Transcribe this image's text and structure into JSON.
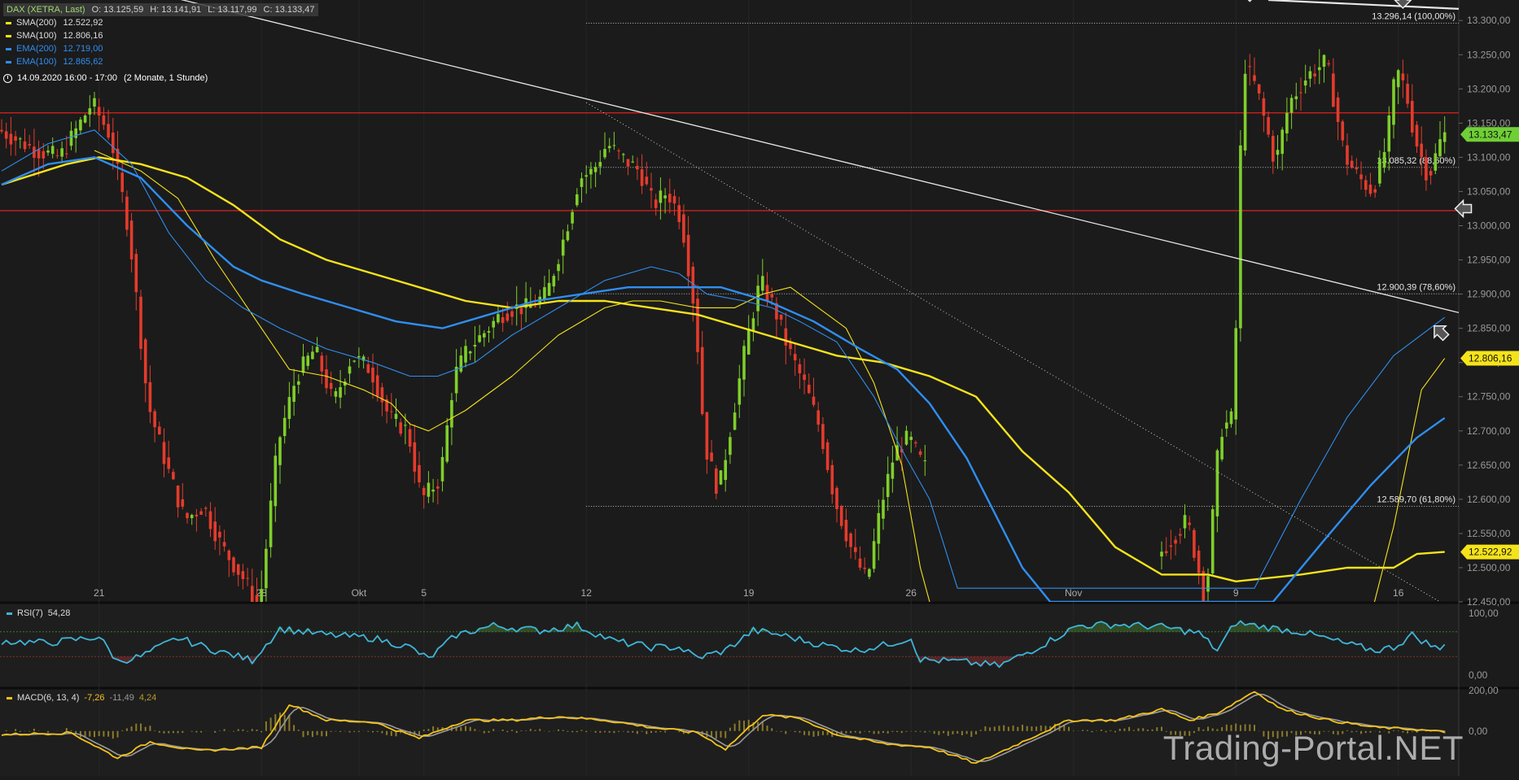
{
  "chart_header": {
    "instrument": "DAX (XETRA, Last)",
    "open": "O: 13.125,59",
    "high": "H: 13.141,91",
    "low": "L: 13.117,99",
    "close": "C: 13.133,47",
    "timestamp": "14.09.2020 16:00 - 17:00",
    "range": "(2 Monate, 1 Stunde)"
  },
  "legend": [
    {
      "label": "SMA(200)",
      "value": "12.522,92",
      "color": "#f5e31a"
    },
    {
      "label": "SMA(100)",
      "value": "12.806,16",
      "color": "#f5e31a"
    },
    {
      "label": "EMA(200)",
      "value": "12.719,00",
      "color": "#2f8ef0"
    },
    {
      "label": "EMA(100)",
      "value": "12.865,62",
      "color": "#2f8ef0"
    }
  ],
  "colors": {
    "background": "#1b1b1b",
    "up_candle": "#7fcf2a",
    "down_candle": "#e53b2c",
    "sma": "#f5e31a",
    "ema": "#2f8ef0",
    "rsi": "#3fb5d8",
    "macd": "#f3c21a",
    "resistance": "#e02020",
    "price_badge": "#6fcf35"
  },
  "chart_data": {
    "type": "candlestick",
    "ylim": [
      12450,
      13330
    ],
    "y_ticks": [
      "13.300,00",
      "13.250,00",
      "13.200,00",
      "13.150,00",
      "13.100,00",
      "13.050,00",
      "13.000,00",
      "12.950,00",
      "12.900,00",
      "12.850,00",
      "12.800,00",
      "12.750,00",
      "12.700,00",
      "12.650,00",
      "12.600,00",
      "12.550,00",
      "12.500,00",
      "12.450,00"
    ],
    "x_ticks": [
      {
        "label": "21",
        "bar": 21
      },
      {
        "label": "28",
        "bar": 56
      },
      {
        "label": "Okt",
        "bar": 77
      },
      {
        "label": "5",
        "bar": 91
      },
      {
        "label": "12",
        "bar": 126
      },
      {
        "label": "19",
        "bar": 161
      },
      {
        "label": "26",
        "bar": 196
      },
      {
        "label": "Nov",
        "bar": 231
      },
      {
        "label": "9",
        "bar": 266
      },
      {
        "label": "16",
        "bar": 301
      }
    ],
    "bar_count": 312,
    "price_path": [
      [
        0,
        13140
      ],
      [
        8,
        13110
      ],
      [
        13,
        13100
      ],
      [
        17,
        13145
      ],
      [
        20,
        13180
      ],
      [
        24,
        13130
      ],
      [
        28,
        12990
      ],
      [
        32,
        12740
      ],
      [
        36,
        12650
      ],
      [
        40,
        12570
      ],
      [
        44,
        12590
      ],
      [
        48,
        12530
      ],
      [
        53,
        12480
      ],
      [
        56,
        12440
      ],
      [
        60,
        12680
      ],
      [
        64,
        12780
      ],
      [
        68,
        12820
      ],
      [
        72,
        12740
      ],
      [
        76,
        12810
      ],
      [
        80,
        12790
      ],
      [
        84,
        12720
      ],
      [
        88,
        12700
      ],
      [
        91,
        12600
      ],
      [
        95,
        12630
      ],
      [
        98,
        12780
      ],
      [
        101,
        12820
      ],
      [
        104,
        12840
      ],
      [
        108,
        12870
      ],
      [
        111,
        12880
      ],
      [
        114,
        12880
      ],
      [
        118,
        12900
      ],
      [
        122,
        12990
      ],
      [
        125,
        13070
      ],
      [
        128,
        13080
      ],
      [
        131,
        13120
      ],
      [
        134,
        13100
      ],
      [
        138,
        13080
      ],
      [
        141,
        13030
      ],
      [
        144,
        13050
      ],
      [
        147,
        13010
      ],
      [
        150,
        12870
      ],
      [
        152,
        12680
      ],
      [
        155,
        12610
      ],
      [
        158,
        12720
      ],
      [
        161,
        12830
      ],
      [
        164,
        12920
      ],
      [
        167,
        12880
      ],
      [
        170,
        12820
      ],
      [
        174,
        12760
      ],
      [
        177,
        12700
      ],
      [
        180,
        12600
      ],
      [
        184,
        12520
      ],
      [
        187,
        12480
      ],
      [
        190,
        12590
      ],
      [
        193,
        12670
      ],
      [
        196,
        12690
      ],
      [
        199,
        12650
      ],
      [
        208,
        12600
      ],
      [
        220,
        12500
      ],
      [
        236,
        12420
      ],
      [
        250,
        12520
      ],
      [
        256,
        12570
      ],
      [
        260,
        12450
      ],
      [
        263,
        12700
      ],
      [
        266,
        12720
      ],
      [
        268,
        13240
      ],
      [
        271,
        13200
      ],
      [
        275,
        13090
      ],
      [
        278,
        13180
      ],
      [
        282,
        13220
      ],
      [
        286,
        13240
      ],
      [
        290,
        13100
      ],
      [
        293,
        13070
      ],
      [
        296,
        13050
      ],
      [
        299,
        13120
      ],
      [
        301,
        13230
      ],
      [
        303,
        13200
      ],
      [
        305,
        13130
      ],
      [
        308,
        13070
      ],
      [
        311,
        13133
      ]
    ],
    "gaps": [
      [
        199,
        250
      ]
    ],
    "series": [
      {
        "name": "SMA(200)",
        "style": "thick",
        "color": "#f5e31a",
        "path": [
          [
            0,
            13060
          ],
          [
            14,
            13090
          ],
          [
            21,
            13100
          ],
          [
            30,
            13090
          ],
          [
            40,
            13070
          ],
          [
            50,
            13030
          ],
          [
            60,
            12980
          ],
          [
            70,
            12950
          ],
          [
            80,
            12930
          ],
          [
            90,
            12910
          ],
          [
            100,
            12890
          ],
          [
            110,
            12880
          ],
          [
            120,
            12890
          ],
          [
            130,
            12890
          ],
          [
            140,
            12880
          ],
          [
            150,
            12870
          ],
          [
            160,
            12850
          ],
          [
            170,
            12830
          ],
          [
            180,
            12810
          ],
          [
            190,
            12800
          ],
          [
            200,
            12780
          ],
          [
            210,
            12750
          ],
          [
            220,
            12670
          ],
          [
            230,
            12610
          ],
          [
            240,
            12530
          ],
          [
            250,
            12490
          ],
          [
            260,
            12490
          ],
          [
            266,
            12480
          ],
          [
            280,
            12490
          ],
          [
            290,
            12500
          ],
          [
            300,
            12500
          ],
          [
            305,
            12520
          ],
          [
            311,
            12523
          ]
        ]
      },
      {
        "name": "SMA(100)",
        "style": "thin",
        "color": "#f5e31a",
        "path": [
          [
            20,
            13110
          ],
          [
            30,
            13080
          ],
          [
            38,
            13040
          ],
          [
            46,
            12950
          ],
          [
            54,
            12870
          ],
          [
            62,
            12790
          ],
          [
            70,
            12780
          ],
          [
            78,
            12760
          ],
          [
            84,
            12740
          ],
          [
            88,
            12710
          ],
          [
            92,
            12700
          ],
          [
            100,
            12730
          ],
          [
            110,
            12780
          ],
          [
            120,
            12840
          ],
          [
            130,
            12880
          ],
          [
            136,
            12890
          ],
          [
            142,
            12890
          ],
          [
            150,
            12880
          ],
          [
            158,
            12880
          ],
          [
            164,
            12900
          ],
          [
            170,
            12910
          ],
          [
            176,
            12880
          ],
          [
            182,
            12850
          ],
          [
            188,
            12770
          ],
          [
            194,
            12650
          ],
          [
            198,
            12500
          ],
          [
            202,
            12400
          ],
          [
            294,
            12400
          ],
          [
            300,
            12560
          ],
          [
            306,
            12760
          ],
          [
            311,
            12806
          ]
        ]
      },
      {
        "name": "EMA(200)",
        "style": "thick",
        "color": "#2f8ef0",
        "path": [
          [
            0,
            13060
          ],
          [
            10,
            13090
          ],
          [
            20,
            13100
          ],
          [
            30,
            13070
          ],
          [
            40,
            13000
          ],
          [
            50,
            12940
          ],
          [
            56,
            12920
          ],
          [
            65,
            12900
          ],
          [
            75,
            12880
          ],
          [
            85,
            12860
          ],
          [
            95,
            12850
          ],
          [
            105,
            12870
          ],
          [
            115,
            12890
          ],
          [
            125,
            12900
          ],
          [
            135,
            12910
          ],
          [
            145,
            12910
          ],
          [
            155,
            12910
          ],
          [
            165,
            12890
          ],
          [
            175,
            12860
          ],
          [
            185,
            12820
          ],
          [
            193,
            12790
          ],
          [
            200,
            12740
          ],
          [
            208,
            12660
          ],
          [
            214,
            12580
          ],
          [
            220,
            12500
          ],
          [
            226,
            12450
          ],
          [
            274,
            12450
          ],
          [
            285,
            12540
          ],
          [
            295,
            12620
          ],
          [
            305,
            12690
          ],
          [
            311,
            12719
          ]
        ]
      },
      {
        "name": "EMA(100)",
        "style": "thin",
        "color": "#2f8ef0",
        "path": [
          [
            0,
            13080
          ],
          [
            10,
            13120
          ],
          [
            20,
            13140
          ],
          [
            28,
            13090
          ],
          [
            36,
            12990
          ],
          [
            44,
            12920
          ],
          [
            52,
            12880
          ],
          [
            60,
            12850
          ],
          [
            70,
            12820
          ],
          [
            80,
            12800
          ],
          [
            88,
            12780
          ],
          [
            94,
            12780
          ],
          [
            102,
            12800
          ],
          [
            110,
            12840
          ],
          [
            120,
            12880
          ],
          [
            130,
            12920
          ],
          [
            140,
            12940
          ],
          [
            146,
            12930
          ],
          [
            152,
            12900
          ],
          [
            160,
            12890
          ],
          [
            166,
            12880
          ],
          [
            172,
            12860
          ],
          [
            180,
            12830
          ],
          [
            188,
            12750
          ],
          [
            195,
            12660
          ],
          [
            200,
            12600
          ],
          [
            206,
            12470
          ],
          [
            270,
            12470
          ],
          [
            280,
            12600
          ],
          [
            290,
            12720
          ],
          [
            300,
            12810
          ],
          [
            311,
            12866
          ]
        ]
      }
    ],
    "fib_levels": [
      {
        "price": 13296.14,
        "label": "13.296,14 (100,00%)"
      },
      {
        "price": 13085.32,
        "label": "13.085,32 (88,60%)"
      },
      {
        "price": 12900.39,
        "label": "12.900,39 (78,60%)"
      },
      {
        "price": 12589.7,
        "label": "12.589,70 (61,80%)"
      }
    ],
    "horizontal_lines": [
      13165,
      13022
    ],
    "trend_lines": [
      {
        "from": [
          21,
          13360
        ],
        "to": [
          400,
          12730
        ],
        "width": 1.3
      },
      {
        "from": [
          273,
          13330
        ],
        "to": [
          400,
          13290
        ],
        "width": 2.2
      },
      {
        "from": [
          126,
          13180
        ],
        "to": [
          310,
          12450
        ],
        "width": 1,
        "dotted": true
      }
    ],
    "arrows": [
      {
        "dir": "down",
        "bar": 269,
        "price": 13340
      },
      {
        "dir": "down",
        "bar": 302,
        "price": 13330
      },
      {
        "dir": "left",
        "bar": 315,
        "price": 13025
      },
      {
        "dir": "up-left",
        "bar": 310,
        "price": 12845
      }
    ],
    "current_price": {
      "value": 13133.47,
      "label": "13.133,47"
    },
    "price_badges": [
      {
        "label": "13.133,47",
        "price": 13133.47,
        "color": "#6fcf35"
      },
      {
        "label": "12.806,16",
        "price": 12806.16,
        "color": "#f5e31a"
      },
      {
        "label": "12.522,92",
        "price": 12522.92,
        "color": "#f5e31a"
      }
    ]
  },
  "rsi": {
    "label": "RSI(7)",
    "value": "54,28",
    "ticks": [
      "100,00",
      "0,00"
    ],
    "ylim": [
      0,
      100
    ],
    "overbought": 70,
    "oversold": 30,
    "path": [
      [
        0,
        55
      ],
      [
        10,
        52
      ],
      [
        21,
        62
      ],
      [
        25,
        22
      ],
      [
        30,
        30
      ],
      [
        38,
        60
      ],
      [
        46,
        40
      ],
      [
        54,
        24
      ],
      [
        60,
        75
      ],
      [
        70,
        65
      ],
      [
        80,
        60
      ],
      [
        88,
        45
      ],
      [
        92,
        26
      ],
      [
        98,
        65
      ],
      [
        106,
        80
      ],
      [
        116,
        72
      ],
      [
        124,
        80
      ],
      [
        132,
        55
      ],
      [
        140,
        45
      ],
      [
        146,
        45
      ],
      [
        150,
        28
      ],
      [
        156,
        40
      ],
      [
        162,
        72
      ],
      [
        168,
        65
      ],
      [
        176,
        50
      ],
      [
        184,
        40
      ],
      [
        190,
        48
      ],
      [
        196,
        60
      ],
      [
        198,
        25
      ],
      [
        206,
        22
      ],
      [
        215,
        15
      ],
      [
        222,
        40
      ],
      [
        232,
        80
      ],
      [
        240,
        82
      ],
      [
        250,
        78
      ],
      [
        258,
        68
      ],
      [
        262,
        40
      ],
      [
        266,
        85
      ],
      [
        272,
        78
      ],
      [
        280,
        70
      ],
      [
        290,
        50
      ],
      [
        296,
        40
      ],
      [
        300,
        45
      ],
      [
        304,
        65
      ],
      [
        310,
        40
      ],
      [
        311,
        54
      ]
    ]
  },
  "macd": {
    "label": "MACD(6, 13, 4)",
    "value": "-7,26",
    "signal": "-11,49",
    "histogram": "4,24",
    "ticks": [
      "200,00",
      "0,00"
    ],
    "ylim": [
      -240,
      220
    ],
    "path": [
      [
        0,
        -20
      ],
      [
        15,
        -10
      ],
      [
        25,
        -150
      ],
      [
        32,
        -60
      ],
      [
        42,
        -110
      ],
      [
        56,
        -90
      ],
      [
        62,
        150
      ],
      [
        70,
        60
      ],
      [
        80,
        50
      ],
      [
        90,
        -40
      ],
      [
        100,
        60
      ],
      [
        110,
        60
      ],
      [
        120,
        80
      ],
      [
        130,
        60
      ],
      [
        140,
        20
      ],
      [
        150,
        -10
      ],
      [
        156,
        -100
      ],
      [
        164,
        90
      ],
      [
        172,
        70
      ],
      [
        180,
        -20
      ],
      [
        190,
        -70
      ],
      [
        200,
        -90
      ],
      [
        210,
        -180
      ],
      [
        220,
        -60
      ],
      [
        230,
        60
      ],
      [
        240,
        60
      ],
      [
        250,
        120
      ],
      [
        256,
        60
      ],
      [
        262,
        100
      ],
      [
        270,
        220
      ],
      [
        276,
        120
      ],
      [
        286,
        60
      ],
      [
        296,
        20
      ],
      [
        304,
        10
      ],
      [
        311,
        -7
      ]
    ]
  },
  "watermark": "Trading-Portal.NET"
}
